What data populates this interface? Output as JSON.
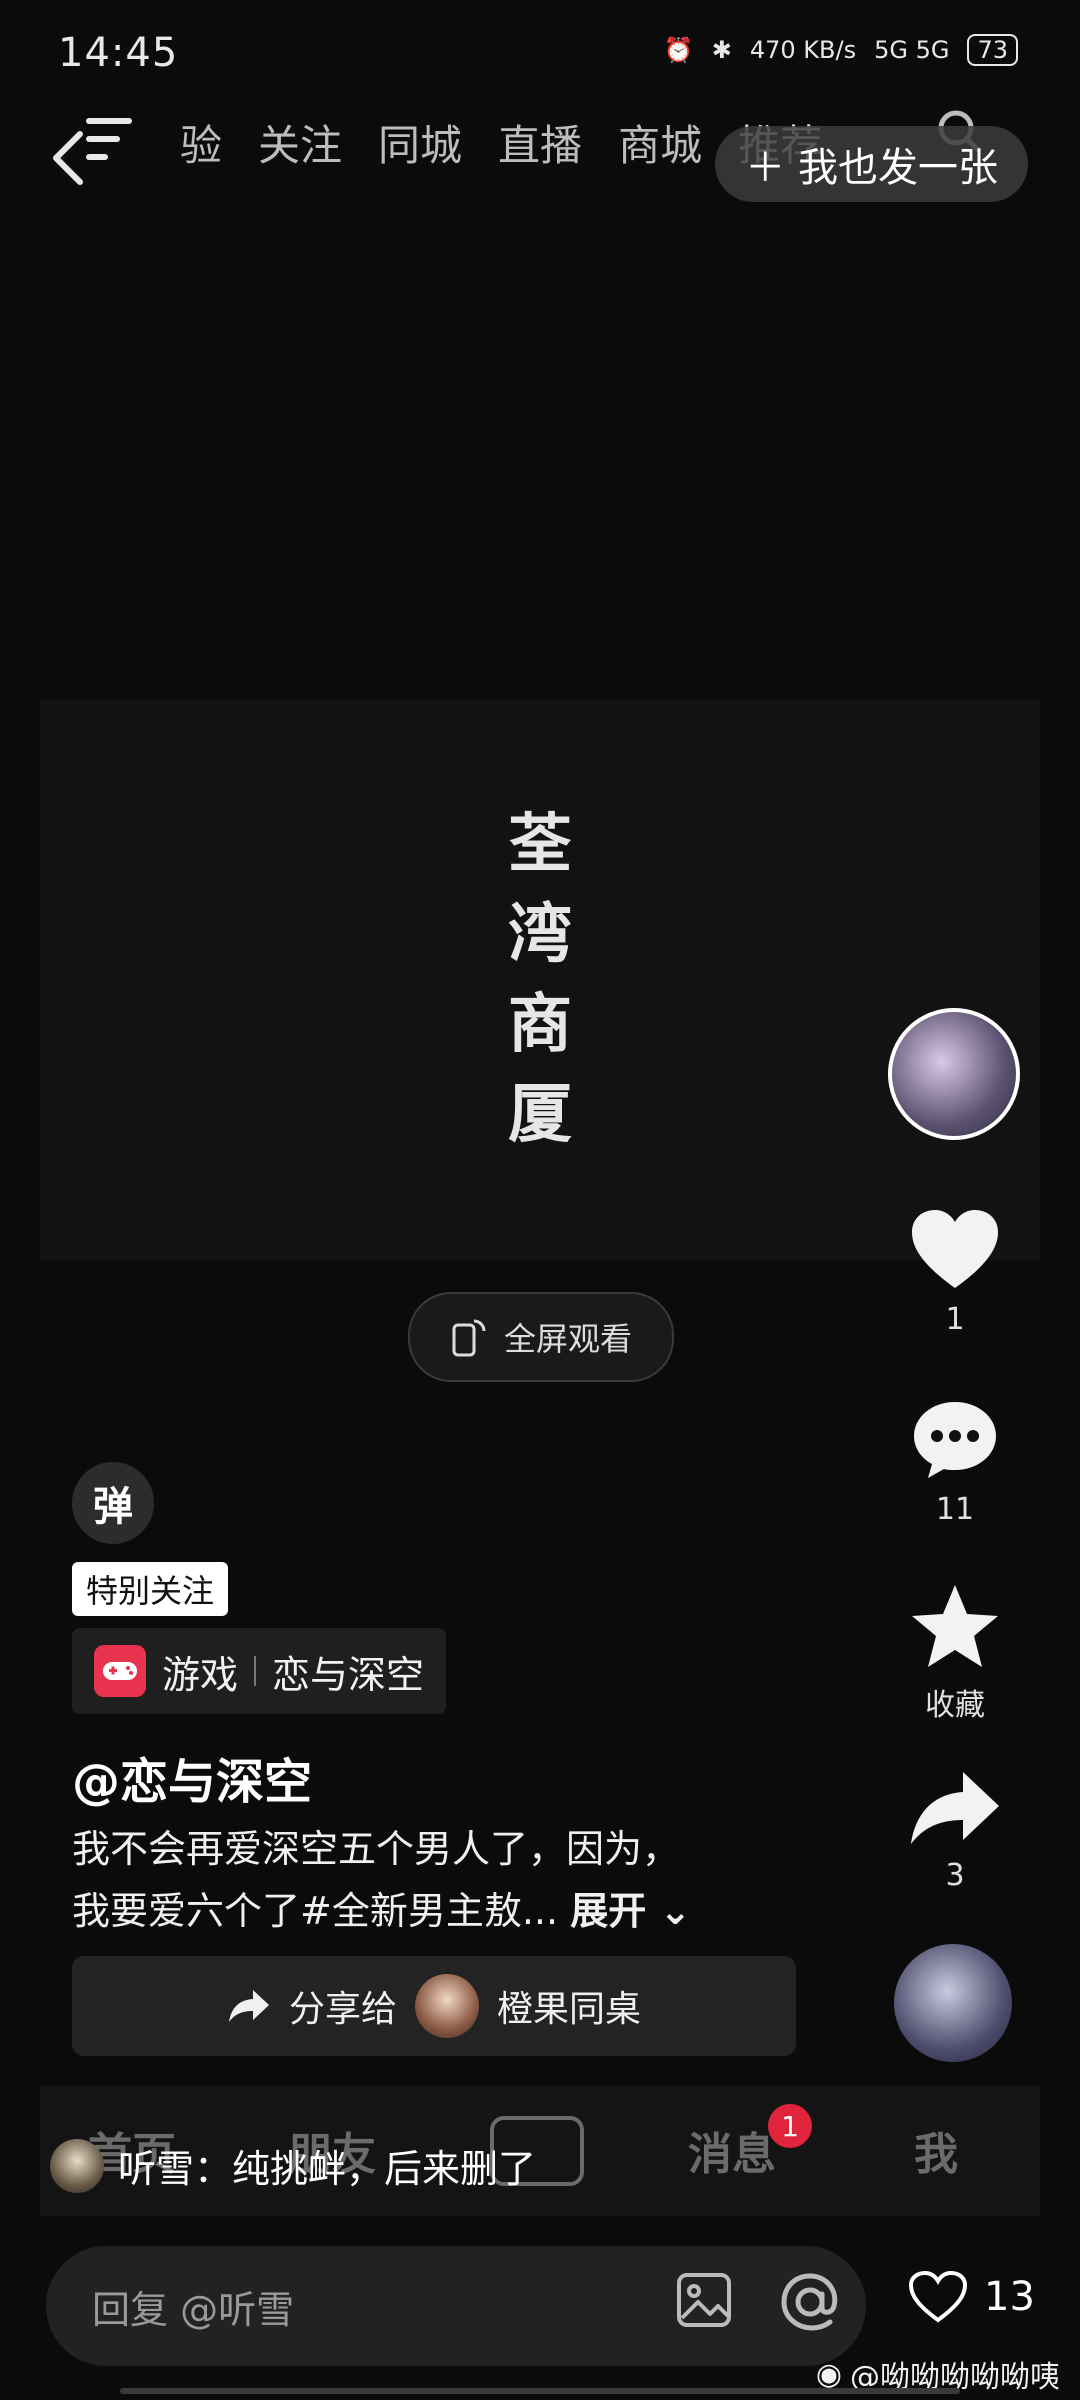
{
  "status": {
    "time": "14:45",
    "net_speed": "470 KB/s",
    "signal": "5G 5G",
    "battery": "73"
  },
  "nav": {
    "tabs": [
      "验",
      "关注",
      "同城",
      "直播",
      "商城",
      "推荐"
    ],
    "post_button": "＋ 我也发一张"
  },
  "video": {
    "calligraphy_lines": [
      "荃",
      "湾",
      "商",
      "厦"
    ],
    "fullscreen_label": "全屏观看"
  },
  "actions": {
    "like_count": "1",
    "comment_count": "11",
    "favorite_label": "收藏",
    "share_count": "3"
  },
  "info": {
    "danmu_label": "弹",
    "special_follow": "特别关注",
    "game_category": "游戏",
    "game_name": "恋与深空",
    "author": "@恋与深空",
    "desc_line1": "我不会再爱深空五个男人了，因为，",
    "desc_line2": "我要爱六个了#全新男主敖...",
    "expand_label": "展开",
    "share_to": "分享给",
    "share_friend": "橙果同桌"
  },
  "bottom_tabs": {
    "home": "首页",
    "friends": "朋友",
    "messages": "消息",
    "messages_badge": "1",
    "me": "我"
  },
  "comment": {
    "user_line": "听雪：纯挑衅，后来删了",
    "reply_placeholder": "回复 @听雪",
    "like_count": "13"
  },
  "watermark": "@呦呦呦呦呦咦",
  "colors": {
    "background": "#0b0b0b",
    "badge": "#e0243c",
    "game_icon": "#e8344e"
  }
}
